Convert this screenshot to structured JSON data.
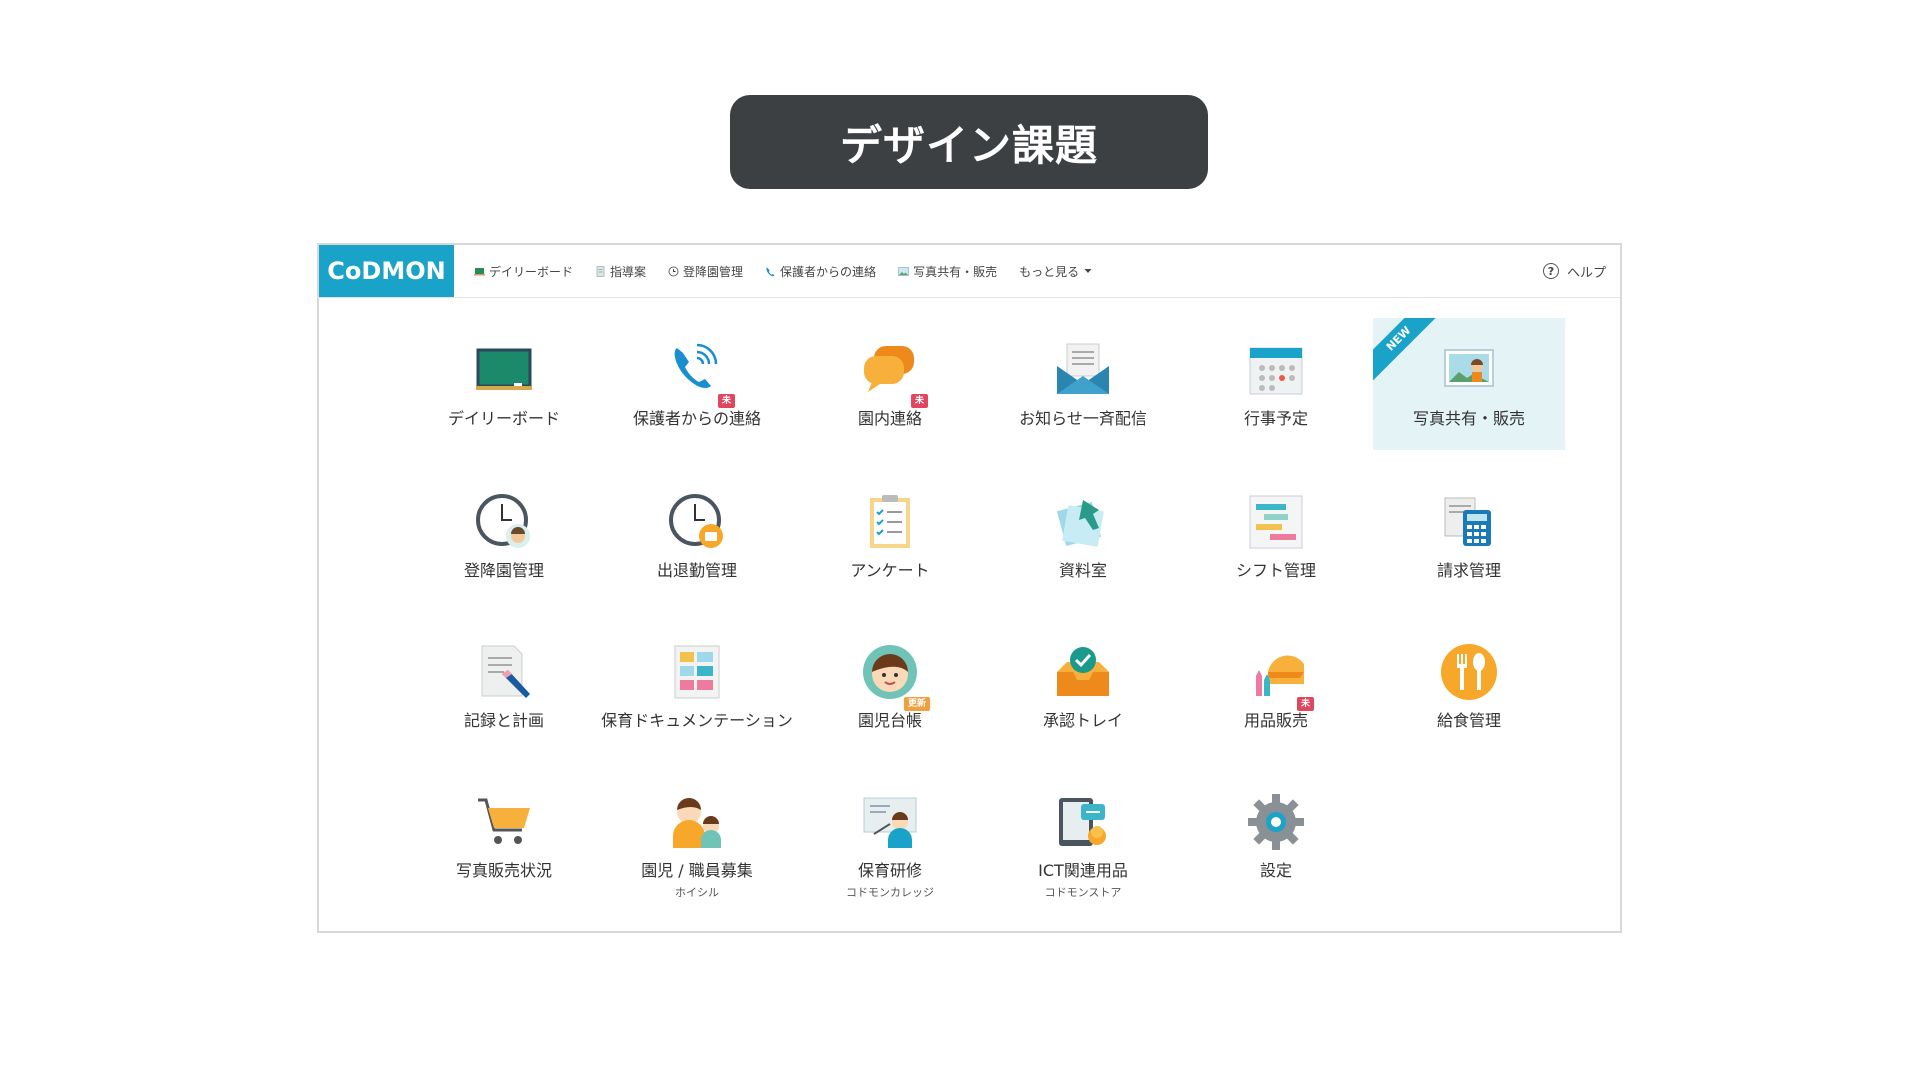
{
  "slide_title": "デザイン課題",
  "logo": "CoDMON",
  "nav": [
    {
      "label": "デイリーボード",
      "icon": "board-icon"
    },
    {
      "label": "指導案",
      "icon": "document-icon"
    },
    {
      "label": "登降園管理",
      "icon": "clock-icon"
    },
    {
      "label": "保護者からの連絡",
      "icon": "phone-icon"
    },
    {
      "label": "写真共有・販売",
      "icon": "photo-icon"
    },
    {
      "label": "もっと見る",
      "icon": "caret-down-icon"
    }
  ],
  "help_label": "ヘルプ",
  "help_symbol": "?",
  "new_label": "NEW",
  "badge_unread": "未",
  "badge_update": "更新",
  "menu": [
    {
      "label": "デイリーボード",
      "icon": "blackboard-icon"
    },
    {
      "label": "保護者からの連絡",
      "icon": "phone-icon",
      "badge": "未"
    },
    {
      "label": "園内連絡",
      "icon": "chat-bubbles-icon",
      "badge": "未"
    },
    {
      "label": "お知らせ一斉配信",
      "icon": "envelope-icon"
    },
    {
      "label": "行事予定",
      "icon": "calendar-icon"
    },
    {
      "label": "写真共有・販売",
      "icon": "photo-icon",
      "new": "NEW"
    },
    {
      "label": "登降園管理",
      "icon": "clock-child-icon"
    },
    {
      "label": "出退勤管理",
      "icon": "clock-bag-icon"
    },
    {
      "label": "アンケート",
      "icon": "clipboard-icon"
    },
    {
      "label": "資料室",
      "icon": "pushpin-docs-icon"
    },
    {
      "label": "シフト管理",
      "icon": "shift-chart-icon"
    },
    {
      "label": "請求管理",
      "icon": "calculator-icon"
    },
    {
      "label": "記録と計画",
      "icon": "pen-note-icon"
    },
    {
      "label": "保育ドキュメンテーション",
      "icon": "documentation-icon"
    },
    {
      "label": "園児台帳",
      "icon": "child-face-icon",
      "badge": "更新"
    },
    {
      "label": "承認トレイ",
      "icon": "approval-tray-icon"
    },
    {
      "label": "用品販売",
      "icon": "cap-crayons-icon",
      "badge": "未"
    },
    {
      "label": "給食管理",
      "icon": "fork-spoon-icon"
    },
    {
      "label": "写真販売状況",
      "icon": "cart-icon"
    },
    {
      "label": "園児 / 職員募集",
      "icon": "people-icon",
      "sub": "ホイシル"
    },
    {
      "label": "保育研修",
      "icon": "teacher-icon",
      "sub": "コドモンカレッジ"
    },
    {
      "label": "ICT関連用品",
      "icon": "tablet-icon",
      "sub": "コドモンストア"
    },
    {
      "label": "設定",
      "icon": "gear-icon"
    }
  ],
  "colors": {
    "brand": "#1aa3c8",
    "title_bg": "#3d4043",
    "badge": "#e0475f",
    "highlight": "#e3f3f6"
  }
}
